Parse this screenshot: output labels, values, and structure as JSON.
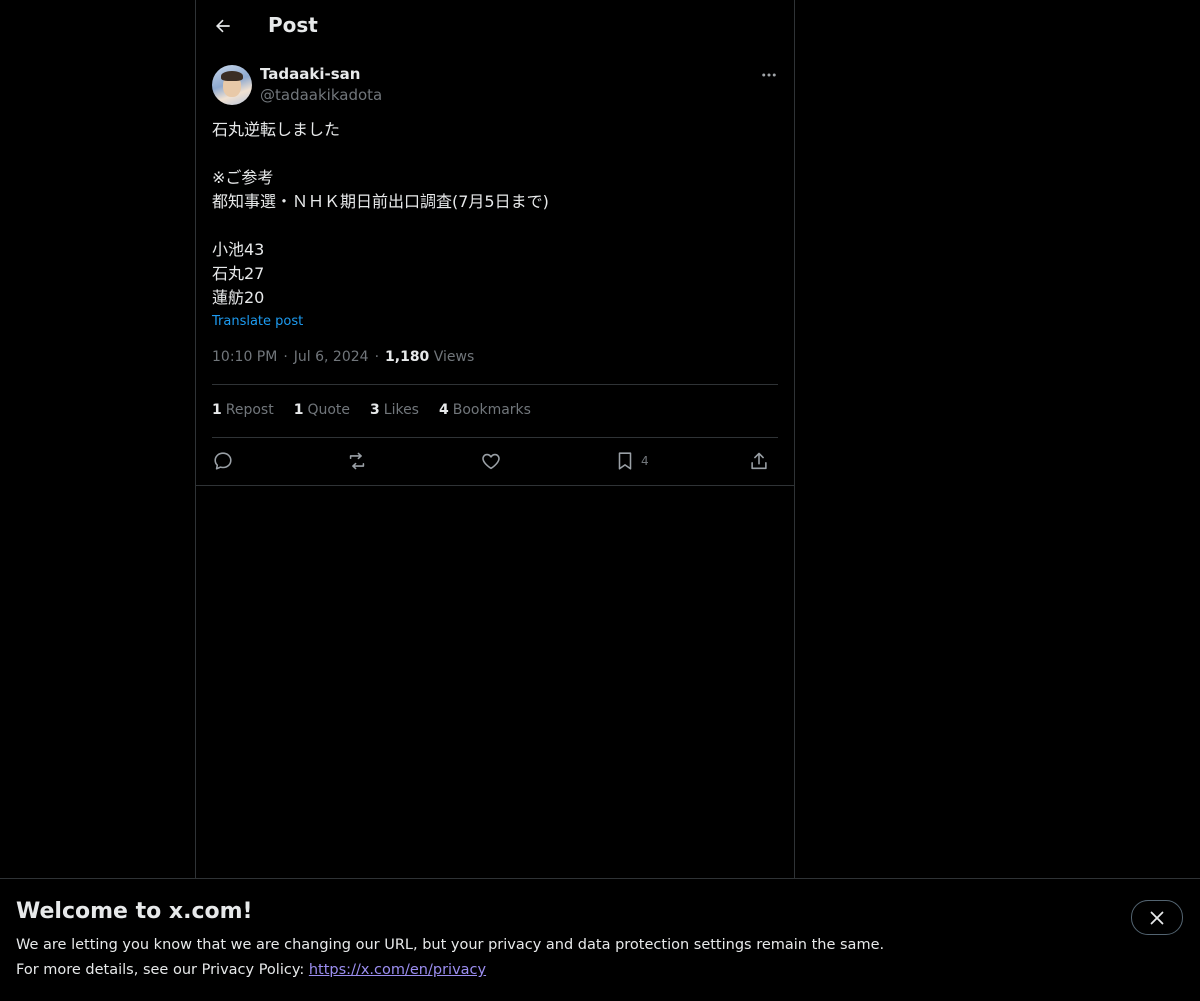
{
  "header": {
    "title": "Post"
  },
  "author": {
    "name": "Tadaaki-san",
    "handle": "@tadaakikadota"
  },
  "post": {
    "lines": [
      "石丸逆転しました",
      "",
      "※ご参考",
      "都知事選・ＮＨＫ期日前出口調査(7月5日まで)",
      "",
      "小池43",
      "石丸27",
      "蓮舫20"
    ],
    "translate_label": "Translate post",
    "time": "10:10 PM",
    "date": "Jul 6, 2024",
    "views_count": "1,180",
    "views_label": "Views"
  },
  "stats": {
    "reposts_count": "1",
    "reposts_label": "Repost",
    "quotes_count": "1",
    "quotes_label": "Quote",
    "likes_count": "3",
    "likes_label": "Likes",
    "bookmarks_count": "4",
    "bookmarks_label": "Bookmarks"
  },
  "actions": {
    "bookmark_count": "4",
    "icons": [
      "reply-icon",
      "repost-icon",
      "like-icon",
      "bookmark-icon",
      "share-icon"
    ]
  },
  "banner": {
    "title": "Welcome to x.com!",
    "line1": "We are letting you know that we are changing our URL, but your privacy and data protection settings remain the same.",
    "line2_prefix": "For more details, see our Privacy Policy: ",
    "link": "https://x.com/en/privacy"
  },
  "colors": {
    "background": "#000000",
    "text": "#e7e9ea",
    "muted": "#71767b",
    "accent": "#1d9bf0",
    "border": "#2f3336"
  }
}
